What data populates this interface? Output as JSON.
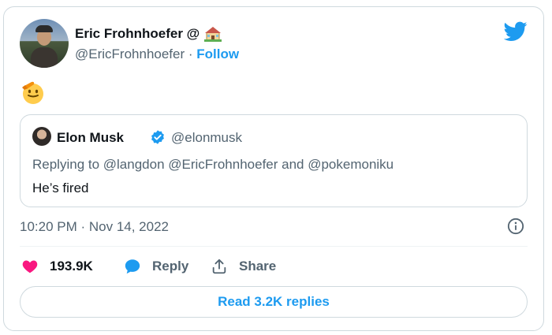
{
  "author": {
    "name": "Eric Frohnhoefer @",
    "handle": "@EricFrohnhoefer",
    "separator": " · ",
    "follow_label": "Follow",
    "name_icon": "house-emoji-icon"
  },
  "tweet": {
    "emoji": "saluting-face-emoji"
  },
  "quoted": {
    "name": "Elon Musk",
    "handle": "@elonmusk",
    "reply_line": "Replying to @langdon @EricFrohnhoefer and @pokemoniku",
    "text": "He’s fired"
  },
  "meta": {
    "timestamp": "10:20 PM · Nov 14, 2022"
  },
  "actions": {
    "likes": "193.9K",
    "reply_label": "Reply",
    "share_label": "Share"
  },
  "footer": {
    "read_replies_label": "Read 3.2K replies"
  },
  "colors": {
    "accent": "#1d9bf0",
    "like": "#f91880",
    "muted": "#536471",
    "border": "#cfd9de"
  }
}
